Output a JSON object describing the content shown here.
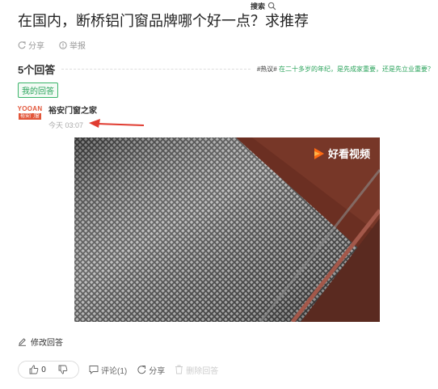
{
  "search": {
    "label": "搜索"
  },
  "question": {
    "title": "在国内，断桥铝门窗品牌哪个好一点？求推荐"
  },
  "meta": {
    "share": "分享",
    "report": "举报"
  },
  "answers": {
    "count_label": "5个回答",
    "hot_prefix": "#热议#",
    "hot_topic": "在二十多岁的年纪，是先成家重要，还是先立业重要？"
  },
  "my_answer_tag": "我的回答",
  "answer": {
    "author_logo_top": "YOOAN",
    "author_logo_bottom": "裕安门窗",
    "author_name": "裕安门窗之家",
    "time": "今天 03:07",
    "video_brand": "好看视频"
  },
  "edit_answer": "修改回答",
  "actions": {
    "like_count": "0",
    "comment": "评论(1)",
    "share": "分享",
    "delete": "删除回答"
  },
  "colors": {
    "accent": "#2aa35b",
    "arrow": "#e03c31",
    "brand": "#e2563a"
  }
}
